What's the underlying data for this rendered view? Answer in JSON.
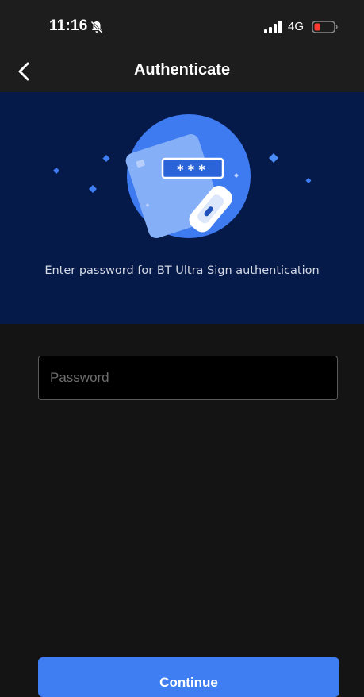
{
  "status_bar": {
    "time": "11:16",
    "network": "4G",
    "silent_icon": "bell-slash-icon",
    "signal_icon": "cellular-signal-icon",
    "battery_icon": "battery-low-icon",
    "battery_color": "#ff3b30"
  },
  "nav": {
    "title": "Authenticate",
    "back_icon": "chevron-left-icon"
  },
  "hero": {
    "background": "#061a4a",
    "illustration_icon": "password-card-key-icon",
    "password_mask": "***",
    "caption": "Enter password for BT Ultra Sign authentication"
  },
  "form": {
    "password_placeholder": "Password",
    "password_value": ""
  },
  "actions": {
    "continue_label": "Continue",
    "accent_color": "#3f7ef2"
  }
}
